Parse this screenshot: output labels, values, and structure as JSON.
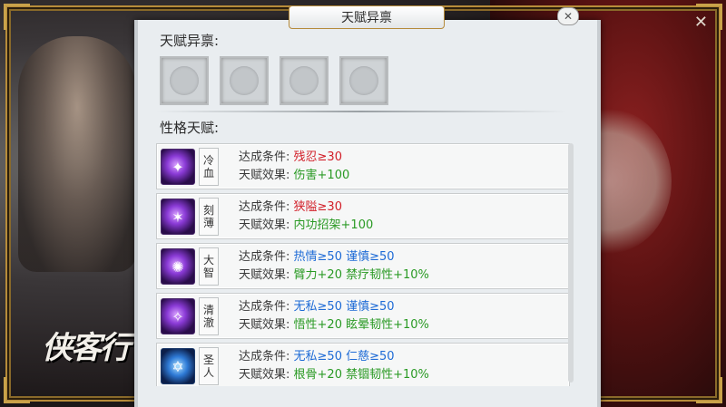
{
  "window": {
    "title": "天赋异禀",
    "close_symbol": "✕"
  },
  "game_logo": "侠客行",
  "talent_section": {
    "title": "天赋异禀:",
    "slot_count": 4
  },
  "personality_section": {
    "title": "性格天赋:"
  },
  "talents": [
    {
      "name": [
        "冷",
        "血"
      ],
      "icon": "dagger-icon",
      "condition_label": "达成条件:",
      "condition": "残忍≥30",
      "condition_color": "red",
      "effect_label": "天赋效果:",
      "effect": "伤害+100"
    },
    {
      "name": [
        "刻",
        "薄"
      ],
      "icon": "claw-icon",
      "condition_label": "达成条件:",
      "condition": "狭隘≥30",
      "condition_color": "red",
      "effect_label": "天赋效果:",
      "effect": "内功招架+100"
    },
    {
      "name": [
        "大",
        "智"
      ],
      "icon": "swirl-icon",
      "condition_label": "达成条件:",
      "condition": "热情≥50 谨慎≥50",
      "condition_color": "blue",
      "effect_label": "天赋效果:",
      "effect": "臂力+20 禁疗韧性+10%"
    },
    {
      "name": [
        "清",
        "澈"
      ],
      "icon": "light-beam-icon",
      "condition_label": "达成条件:",
      "condition": "无私≥50 谨慎≥50",
      "condition_color": "blue",
      "effect_label": "天赋效果:",
      "effect": "悟性+20 眩晕韧性+10%"
    },
    {
      "name": [
        "圣",
        "人"
      ],
      "icon": "hexagram-icon",
      "condition_label": "达成条件:",
      "condition": "无私≥50 仁慈≥50",
      "condition_color": "blue",
      "effect_label": "天赋效果:",
      "effect": "根骨+20 禁锢韧性+10%"
    }
  ]
}
